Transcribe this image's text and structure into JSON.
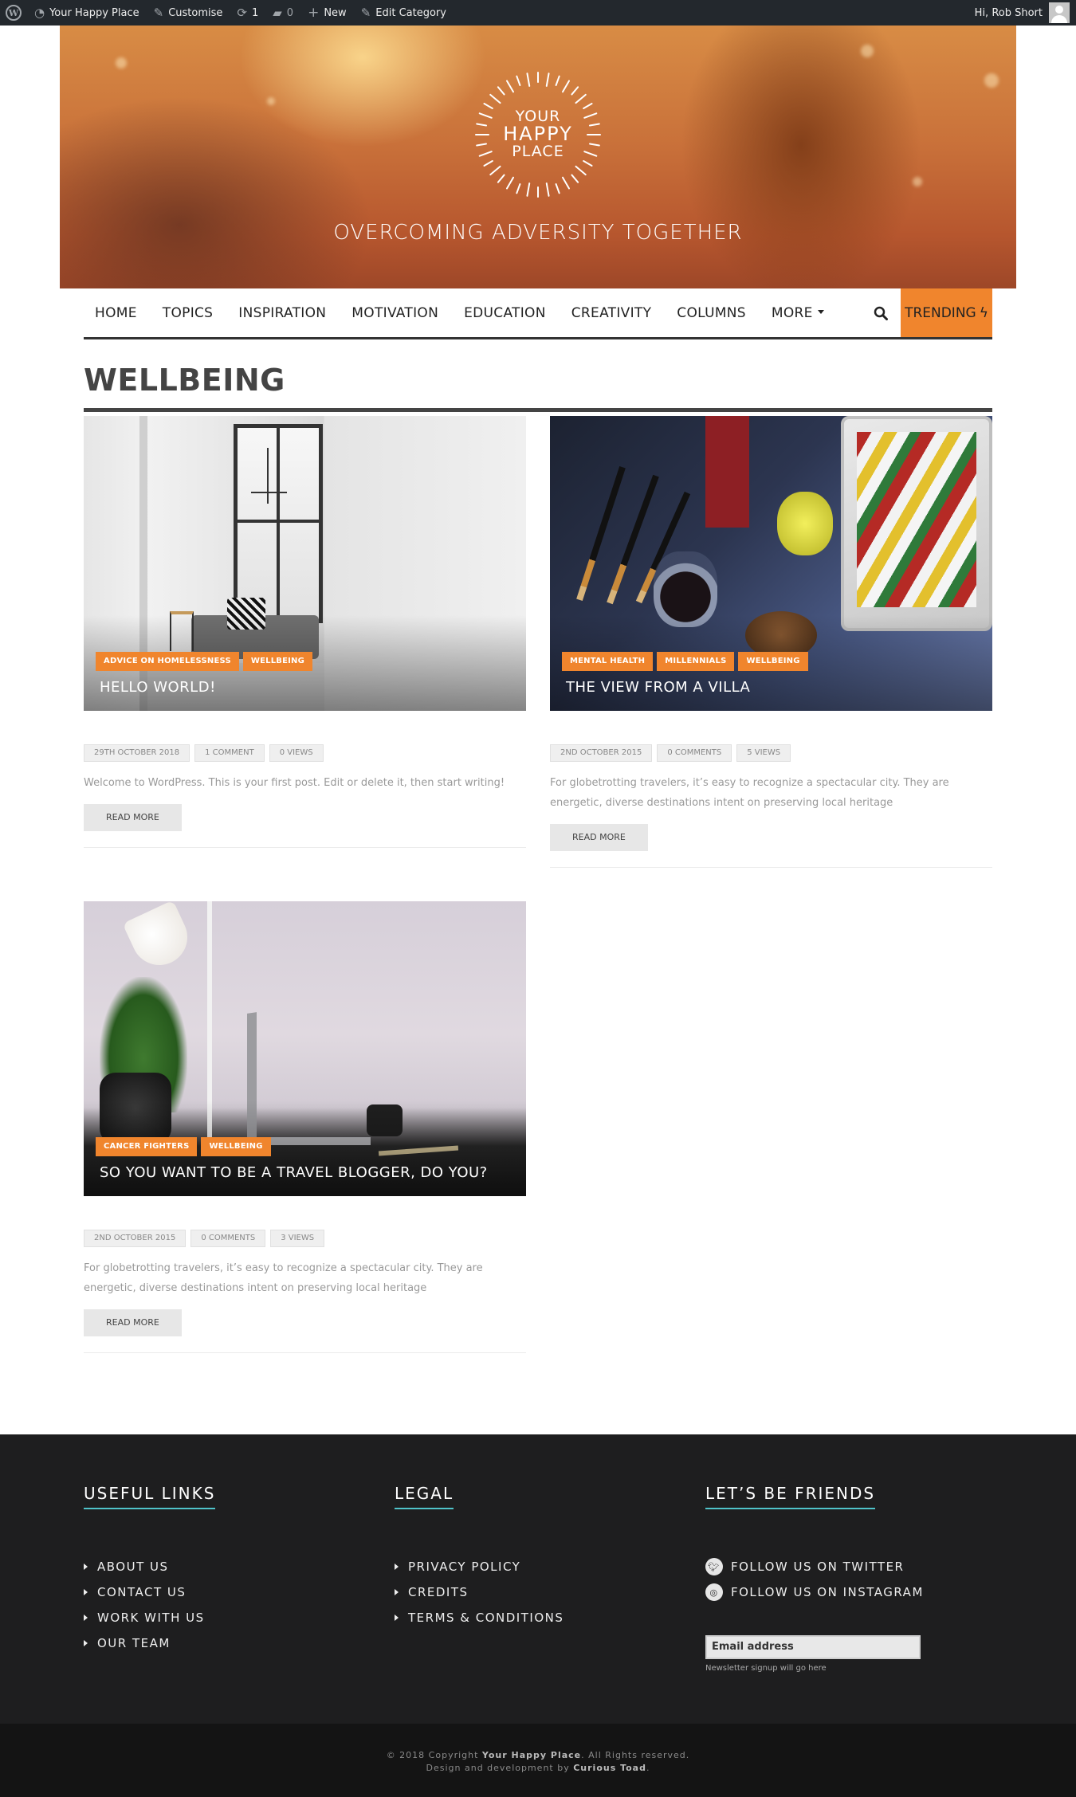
{
  "adminbar": {
    "site_name": "Your Happy Place",
    "customise": "Customise",
    "updates_count": "1",
    "comments_count": "0",
    "new_label": "New",
    "edit_category": "Edit Category",
    "greeting": "Hi, Rob Short"
  },
  "header": {
    "logo_line1": "YOUR",
    "logo_line2": "HAPPY",
    "logo_line3": "PLACE",
    "tagline": "OVERCOMING ADVERSITY TOGETHER"
  },
  "nav": {
    "items": [
      "HOME",
      "TOPICS",
      "INSPIRATION",
      "MOTIVATION",
      "EDUCATION",
      "CREATIVITY",
      "COLUMNS",
      "MORE"
    ],
    "trending": "TRENDING"
  },
  "page": {
    "title": "WELLBEING"
  },
  "posts": [
    {
      "tags": [
        "ADVICE ON HOMELESSNESS",
        "WELLBEING"
      ],
      "title": "HELLO WORLD!",
      "date": "29TH OCTOBER 2018",
      "comments": "1 COMMENT",
      "views": "0 VIEWS",
      "excerpt": "Welcome to WordPress. This is your first post. Edit or delete it, then start writing!",
      "read_more": "READ MORE"
    },
    {
      "tags": [
        "MENTAL HEALTH",
        "MILLENNIALS",
        "WELLBEING"
      ],
      "title": "THE VIEW FROM A VILLA",
      "date": "2ND OCTOBER 2015",
      "comments": "0 COMMENTS",
      "views": "5 VIEWS",
      "excerpt": "For globetrotting travelers, it’s easy to recognize a spectacular city. They are energetic, diverse destinations intent on preserving local heritage",
      "read_more": "READ MORE"
    },
    {
      "tags": [
        "CANCER FIGHTERS",
        "WELLBEING"
      ],
      "title": "SO YOU WANT TO BE A TRAVEL BLOGGER, DO YOU?",
      "date": "2ND OCTOBER 2015",
      "comments": "0 COMMENTS",
      "views": "3 VIEWS",
      "excerpt": "For globetrotting travelers, it’s easy to recognize a spectacular city. They are energetic, diverse destinations intent on preserving local heritage",
      "read_more": "READ MORE"
    }
  ],
  "footer": {
    "useful_links": {
      "heading": "USEFUL LINKS",
      "items": [
        "ABOUT US",
        "CONTACT US",
        "WORK WITH US",
        "OUR TEAM"
      ]
    },
    "legal": {
      "heading": "LEGAL",
      "items": [
        "PRIVACY POLICY",
        "CREDITS",
        "TERMS & CONDITIONS"
      ]
    },
    "friends": {
      "heading": "LET’S BE FRIENDS",
      "twitter": "FOLLOW US ON TWITTER",
      "instagram": "FOLLOW US ON INSTAGRAM",
      "email_placeholder": "Email address",
      "newsletter_note": "Newsletter signup will go here"
    }
  },
  "copyright": {
    "line1_prefix": "© 2018 Copyright ",
    "line1_site": "Your Happy Place",
    "line1_suffix": ". All Rights reserved.",
    "line2_prefix": "Design and development by ",
    "line2_company": "Curious Toad",
    "line2_suffix": "."
  },
  "colors": {
    "accent": "#f0852d",
    "footer_underline": "#4fc3c9",
    "adminbar": "#23282d"
  }
}
